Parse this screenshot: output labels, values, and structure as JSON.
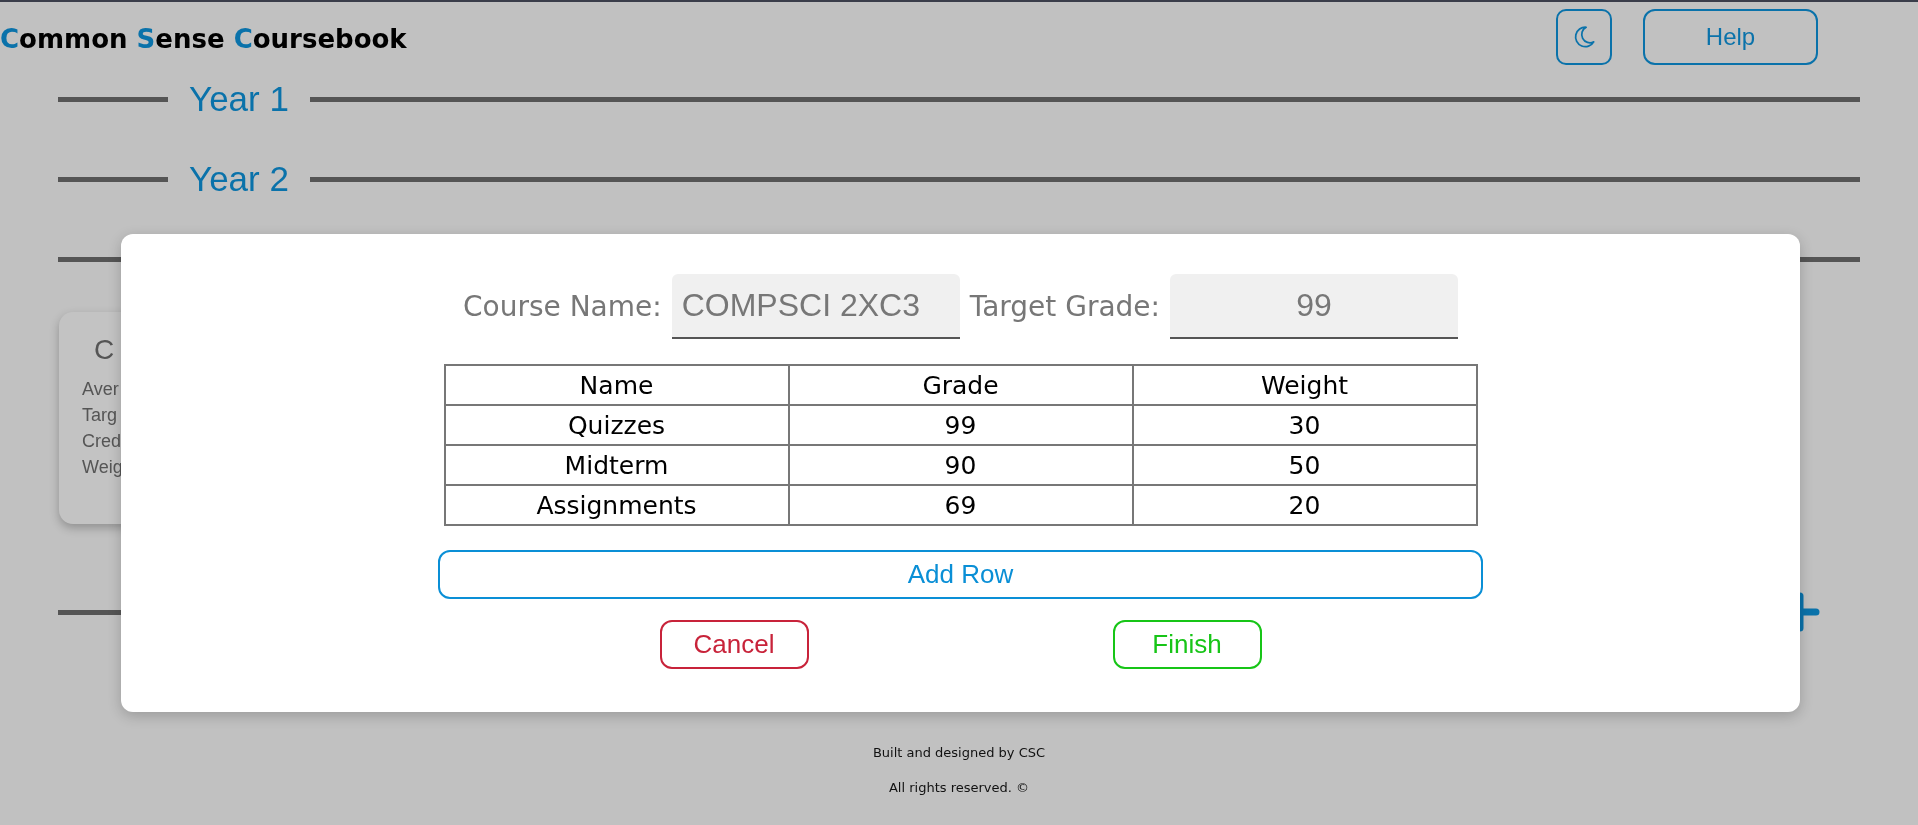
{
  "header": {
    "title_words": [
      {
        "initial": "C",
        "rest": "ommon"
      },
      {
        "initial": "S",
        "rest": "ense"
      },
      {
        "initial": "C",
        "rest": "oursebook"
      }
    ],
    "help_button": "Help"
  },
  "years": [
    {
      "label": "Year 1"
    },
    {
      "label": "Year 2"
    }
  ],
  "course_card": {
    "title": "C",
    "lines": [
      "Aver",
      "Targ",
      "Cred",
      "Weig"
    ]
  },
  "dialog": {
    "course_name": {
      "label": "Course Name:",
      "value": "COMPSCI 2XC3"
    },
    "target_grade": {
      "label": "Target Grade:",
      "value": "99"
    },
    "table": {
      "columns": [
        "Name",
        "Grade",
        "Weight"
      ],
      "rows": [
        [
          "Quizzes",
          "99",
          "30"
        ],
        [
          "Midterm",
          "90",
          "50"
        ],
        [
          "Assignments",
          "69",
          "20"
        ]
      ]
    },
    "add_row": "Add Row",
    "buttons": [
      {
        "label": "Cancel",
        "kind": "cancel"
      },
      {
        "label": "Finish",
        "kind": "finish"
      }
    ]
  },
  "footer": [
    "Built and designed by CSC",
    "All rights reserved. ©"
  ]
}
